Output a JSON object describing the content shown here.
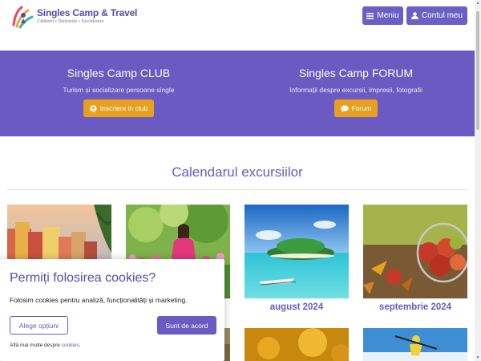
{
  "header": {
    "brand_title": "Singles Camp & Travel",
    "brand_subtitle": "Călătorii • Distracție • Socializare",
    "menu_label": "Meniu",
    "account_label": "Contul meu"
  },
  "hero": {
    "club": {
      "title": "Singles Camp CLUB",
      "subtitle": "Turism și socializare persoane single",
      "button": "Inscriere in club"
    },
    "forum": {
      "title": "Singles Camp FORUM",
      "subtitle": "Informații despre excursii, impresii, fotografii",
      "button": "Forum"
    }
  },
  "calendar": {
    "title": "Calendarul excursiilor",
    "cards": [
      {
        "label": "",
        "image": "coastal-village-photo"
      },
      {
        "label": "",
        "image": "woman-in-flower-garden-photo"
      },
      {
        "label": "august 2024",
        "image": "tropical-island-boat-photo"
      },
      {
        "label": "septembrie 2024",
        "image": "autumn-apples-basket-photo"
      },
      {
        "label": "",
        "image": "sunflower-field-photo"
      },
      {
        "label": "",
        "image": "skier-snow-photo"
      }
    ]
  },
  "cookie": {
    "title": "Permiți folosirea cookies?",
    "text": "Folosim cookies pentru analiză, funcționalități și marketing.",
    "options_button": "Alege opțiuni",
    "accept_button": "Sunt de acord",
    "more_text": "Află mai multe despre",
    "more_link": "cookies",
    "more_suffix": "."
  },
  "colors": {
    "accent": "#6a5ac2",
    "orange": "#e8a020"
  }
}
